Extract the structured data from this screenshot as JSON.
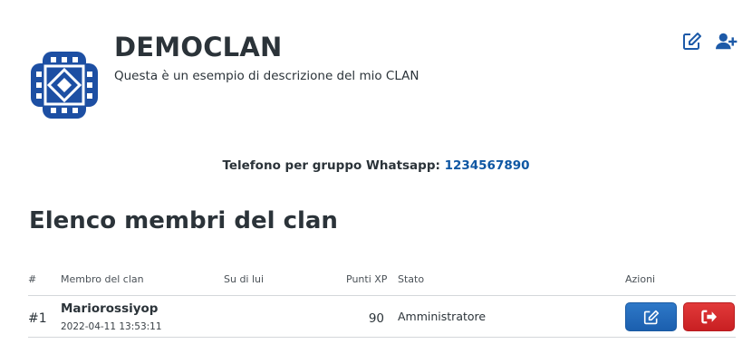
{
  "clan": {
    "name": "DEMOCLAN",
    "description": "Questa è un esempio di descrizione del mio CLAN",
    "logo_icon": "clan-pattern-logo",
    "logo_color": "#1d4fa3"
  },
  "header_actions": {
    "edit_icon": "edit-square-icon",
    "add_member_icon": "user-plus-icon",
    "icon_color": "#1d5aa8"
  },
  "whatsapp": {
    "label": "Telefono per gruppo Whatsapp:",
    "number": "1234567890",
    "link_color": "#0f57a3"
  },
  "members_section": {
    "title": "Elenco membri del clan",
    "columns": {
      "num": "#",
      "member": "Membro del clan",
      "about": "Su di lui",
      "points": "Punti XP",
      "status": "Stato",
      "actions": "Azioni"
    },
    "rows": [
      {
        "num": "#1",
        "name": "Mariorossiyop",
        "joined": "2022-04-11 13:53:11",
        "about": "",
        "points": "90",
        "status": "Amministratore",
        "edit_icon": "edit-icon",
        "leave_icon": "sign-out-icon"
      }
    ]
  },
  "colors": {
    "primary_button": "#1f63b3",
    "danger_button": "#d42a2c",
    "text": "#2b3339"
  }
}
